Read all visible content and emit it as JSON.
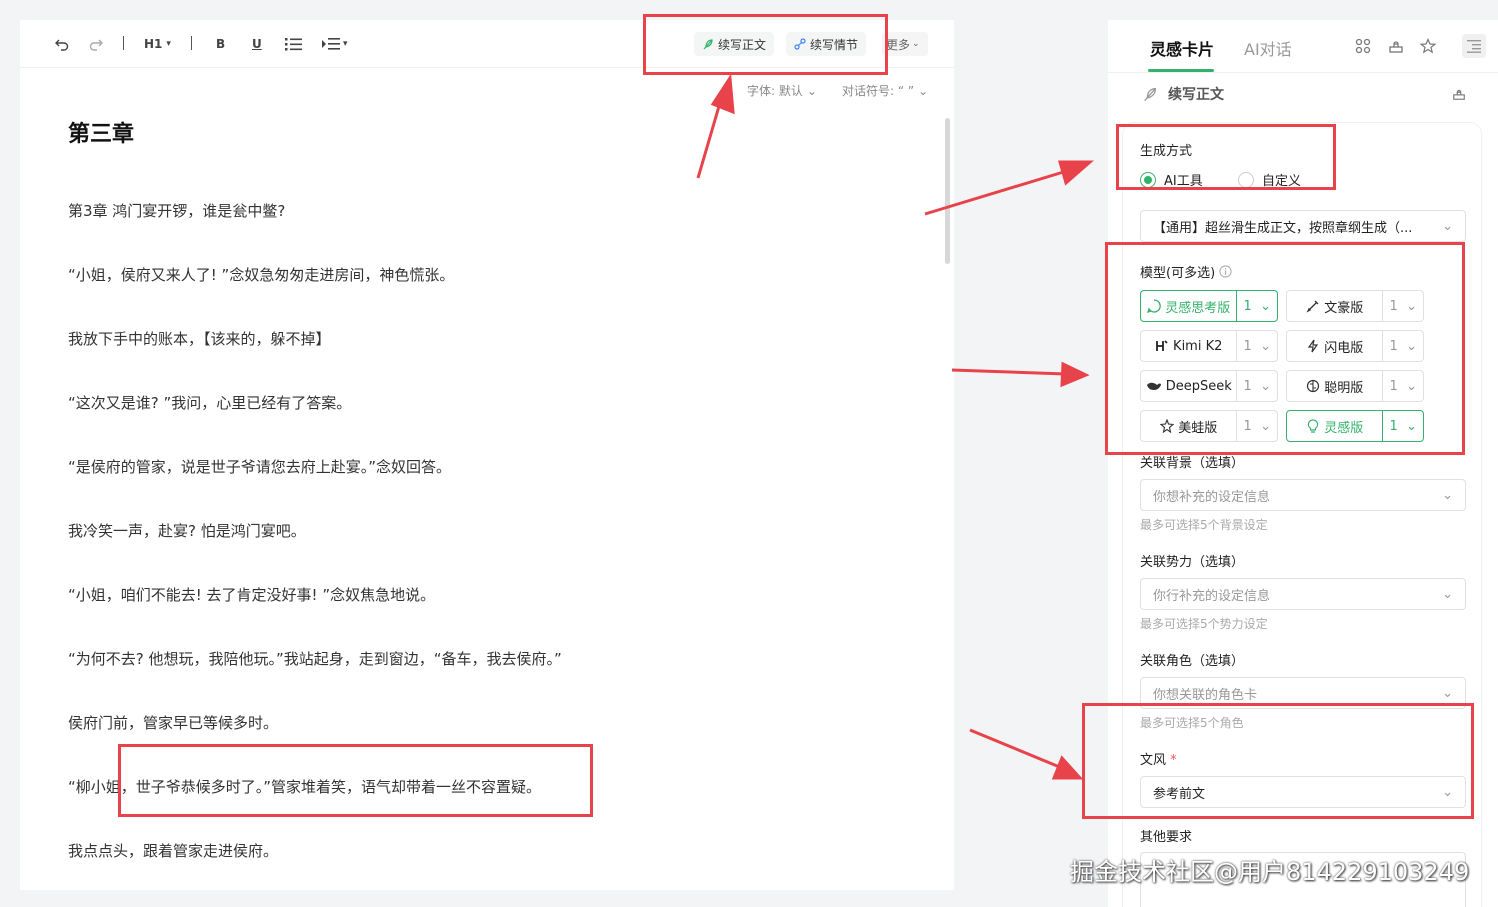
{
  "toolbar": {
    "heading": "H1",
    "bold": "B",
    "underline": "U",
    "continue_text": "续写正文",
    "continue_plot": "续写情节",
    "more": "更多",
    "font_option": "字体: 默认",
    "quote_option": "对话符号: “ ”"
  },
  "document": {
    "title": "第三章",
    "paragraphs": [
      "第3章 鸿门宴开锣，谁是瓮中鳖?",
      "“小姐，侯府又来人了! ”念奴急匆匆走进房间，神色慌张。",
      "我放下手中的账本，【该来的，躲不掉】",
      "“这次又是谁? ”我问，心里已经有了答案。",
      "“是侯府的管家，说是世子爷请您去府上赴宴。”念奴回答。",
      "我冷笑一声，赴宴? 怕是鸿门宴吧。",
      "“小姐，咱们不能去! 去了肯定没好事! ”念奴焦急地说。",
      "“为何不去? 他想玩，我陪他玩。”我站起身，走到窗边，“备车，我去侯府。”",
      "侯府门前，管家早已等候多时。",
      "“柳小姐，世子爷恭候多时了。”管家堆着笑，语气却带着一丝不容置疑。",
      "我点点头，跟着管家走进侯府。"
    ]
  },
  "panel": {
    "tabs": [
      "灵感卡片",
      "AI对话"
    ],
    "sub_title": "续写正文",
    "gen_method_label": "生成方式",
    "radio_ai": "AI工具",
    "radio_custom": "自定义",
    "preset_value": "【通用】超丝滑生成正文，按照章纲生成（...",
    "model_label": "模型(可多选)",
    "models": [
      {
        "name": "灵感思考版",
        "count": "1",
        "selected": true
      },
      {
        "name": "文豪版",
        "count": "1",
        "selected": false
      },
      {
        "name": "Kimi K2",
        "count": "1",
        "selected": false
      },
      {
        "name": "闪电版",
        "count": "1",
        "selected": false
      },
      {
        "name": "DeepSeek",
        "count": "1",
        "selected": false
      },
      {
        "name": "聪明版",
        "count": "1",
        "selected": false
      },
      {
        "name": "美蛙版",
        "count": "1",
        "selected": false
      },
      {
        "name": "灵感版",
        "count": "1",
        "selected": true
      }
    ],
    "bg_label": "关联背景（选填）",
    "bg_placeholder": "你想补充的设定信息",
    "bg_hint": "最多可选择5个背景设定",
    "force_label": "关联势力（选填）",
    "force_placeholder": "你行补充的设定信息",
    "force_hint": "最多可选择5个势力设定",
    "role_label": "关联角色（选填）",
    "role_placeholder": "你想关联的角色卡",
    "role_hint": "最多可选择5个角色",
    "style_label": "文风",
    "style_required": "*",
    "style_value": "参考前文",
    "other_label": "其他要求"
  },
  "watermark": "掘金技术社区@用户814229103249",
  "colors": {
    "accent": "#34b16a",
    "annotation": "#e8434a"
  }
}
